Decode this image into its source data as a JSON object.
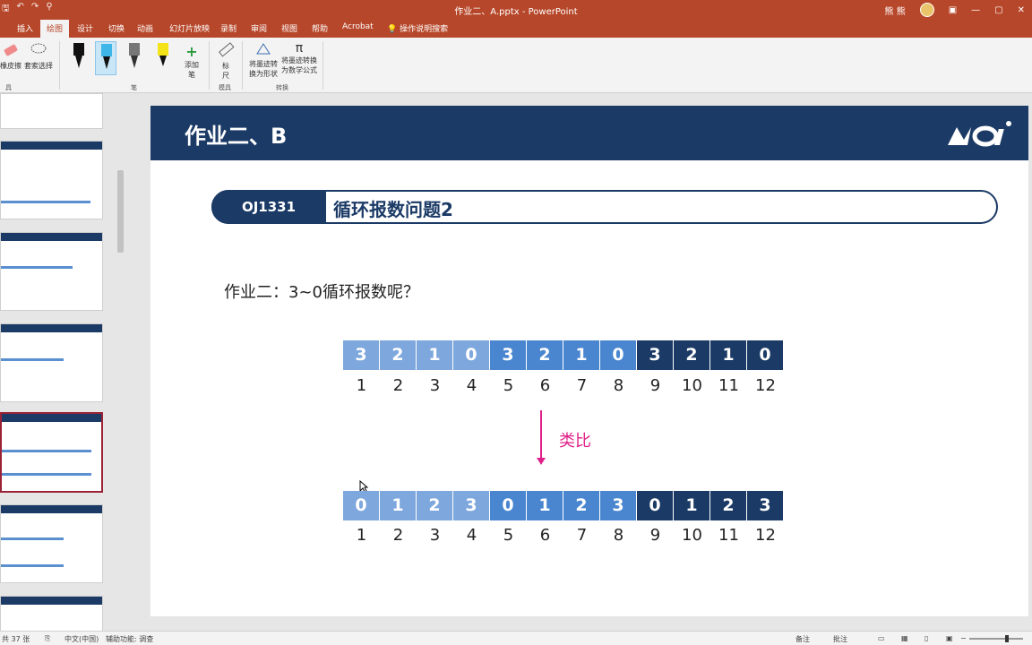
{
  "window": {
    "title": "作业二、A.pptx  -  PowerPoint",
    "user": "熊 熊"
  },
  "tabs": [
    {
      "label": "插入"
    },
    {
      "label": "绘图"
    },
    {
      "label": "设计"
    },
    {
      "label": "切换"
    },
    {
      "label": "动画"
    },
    {
      "label": "幻灯片放映"
    },
    {
      "label": "录制"
    },
    {
      "label": "审阅"
    },
    {
      "label": "视图"
    },
    {
      "label": "帮助"
    },
    {
      "label": "Acrobat"
    }
  ],
  "tell_me": "操作说明搜索",
  "ribbon": {
    "eraser": "橡皮擦",
    "lasso": "套索选择",
    "add_pen": "添加",
    "add_pen2": "笔",
    "ruler": "标",
    "ruler2": "尺",
    "ink_to_shape": "将墨迹转",
    "ink_to_shape2": "换为形状",
    "ink_to_math": "将墨迹转换",
    "ink_to_math2": "为数学公式",
    "group_tools": "具",
    "group_pens": "笔",
    "group_stencils": "模具",
    "group_convert": "转换"
  },
  "slide": {
    "title": "作业二、B",
    "oj_id": "OJ1331",
    "problem_title": "循环报数问题2",
    "question": "作业二：3~0循环报数呢？",
    "analogy": "类比",
    "row1_values": [
      "3",
      "2",
      "1",
      "0",
      "3",
      "2",
      "1",
      "0",
      "3",
      "2",
      "1",
      "0"
    ],
    "row2_values": [
      "0",
      "1",
      "2",
      "3",
      "0",
      "1",
      "2",
      "3",
      "0",
      "1",
      "2",
      "3"
    ],
    "indices": [
      "1",
      "2",
      "3",
      "4",
      "5",
      "6",
      "7",
      "8",
      "9",
      "10",
      "11",
      "12"
    ]
  },
  "status": {
    "slide_count": "共 37 张",
    "language": "中文(中国)",
    "accessibility": "辅助功能: 调查",
    "notes": "备注",
    "comments": "批注"
  },
  "colors": {
    "powerpoint_red": "#b7472a",
    "navy": "#1b3a66",
    "light_blue": "#7ea7dd",
    "mid_blue": "#4a86d0",
    "magenta": "#e0208a"
  }
}
